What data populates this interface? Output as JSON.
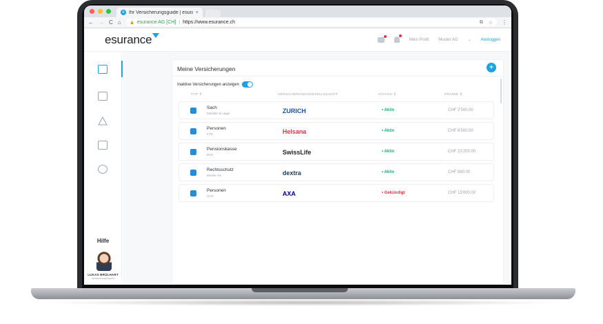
{
  "browser": {
    "tab_title": "Ihr Versicherungsguide | esura",
    "tab_close": "×",
    "tab_favicon": "e",
    "nav_back": "←",
    "nav_forward": "→",
    "nav_reload": "C",
    "nav_home": "⌂",
    "lock": "🔒",
    "site_name": "esurance AG [CH]",
    "separator": "|",
    "url": "https://www.esurance.ch",
    "translate_icon": "⧉",
    "star_icon": "☆",
    "menu_icon": "⋮"
  },
  "header": {
    "logo": "esurance",
    "profile": "Mein Profil",
    "company": "Muster AG",
    "chevron": "⌄",
    "logout": "Ausloggen"
  },
  "sidebar": {
    "help": "Hilfe",
    "person_name": "LUKAS BRÜLHART",
    "person_role": "Versicherungsexperte"
  },
  "card": {
    "title": "Meine Versicherungen",
    "add": "+",
    "toggle_label": "Inaktive Versicherungen anzeigen",
    "columns": {
      "type": "TYP ⇕",
      "insurer": "VERSICHERUNGSGESELLSCHAFT",
      "status": "STATUS ⇕",
      "premium": "PRÄMIE ⇕"
    },
    "rows": [
      {
        "name": "Sach",
        "sub": "Mobilien & Lager",
        "insurer": "ZURICH",
        "insurer_color": "#1d4fa0",
        "status": "• Aktiv",
        "status_color": "#21a67a",
        "premium": "CHF 2'500.00",
        "icon_color": "#2b8ad6"
      },
      {
        "name": "Personen",
        "sub": "KTG",
        "insurer": "Helsana",
        "insurer_color": "#e3334a",
        "status": "• Aktiv",
        "status_color": "#21a67a",
        "premium": "CHF 6'500.00",
        "icon_color": "#2b8ad6"
      },
      {
        "name": "Pensionskasse",
        "sub": "BVG",
        "insurer": "SwissLife",
        "insurer_color": "#222222",
        "status": "• Aktiv",
        "status_color": "#21a67a",
        "premium": "CHF 23'200.00",
        "icon_color": "#2b8ad6"
      },
      {
        "name": "Rechtsschutz",
        "sub": "Muster AG",
        "insurer": "dextra",
        "insurer_color": "#1f3a5a",
        "status": "• Aktiv",
        "status_color": "#21a67a",
        "premium": "CHF 890.00",
        "icon_color": "#2b8ad6"
      },
      {
        "name": "Personen",
        "sub": "UVG",
        "insurer": "AXA",
        "insurer_color": "#00008f",
        "status": "• Gekündigt",
        "status_color": "#e3334a",
        "premium": "CHF 15'000.00",
        "icon_color": "#2b8ad6"
      }
    ]
  }
}
